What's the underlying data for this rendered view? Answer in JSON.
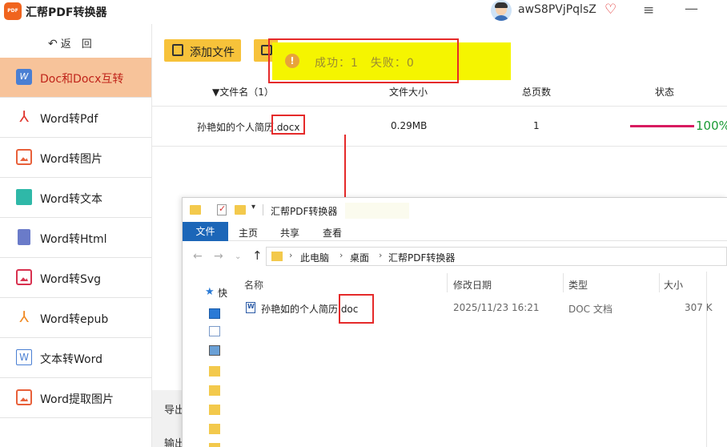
{
  "app": {
    "logo_text": "PDF",
    "title": "汇帮PDF转换器",
    "username": "awS8PVjPqlsZ",
    "icons": {
      "vip": "vip-heart-icon",
      "menu": "hamburger-menu-icon",
      "minimize": "minimize-icon"
    }
  },
  "sidebar": {
    "back_label": "返　回",
    "items": [
      {
        "label": "Doc和Docx互转",
        "icon": "word-doc-icon",
        "active": true
      },
      {
        "label": "Word转Pdf",
        "icon": "pdf-icon",
        "active": false
      },
      {
        "label": "Word转图片",
        "icon": "image-icon",
        "active": false
      },
      {
        "label": "Word转文本",
        "icon": "text-file-icon",
        "active": false
      },
      {
        "label": "Word转Html",
        "icon": "html-file-icon",
        "active": false
      },
      {
        "label": "Word转Svg",
        "icon": "svg-image-icon",
        "active": false
      },
      {
        "label": "Word转epub",
        "icon": "epub-icon",
        "active": false
      },
      {
        "label": "文本转Word",
        "icon": "word-icon",
        "active": false
      },
      {
        "label": "Word提取图片",
        "icon": "extract-image-icon",
        "active": false
      }
    ]
  },
  "toolbar": {
    "add_file_label": "添加文件"
  },
  "toast": {
    "message": "成功：1　失败：0"
  },
  "table": {
    "headers": {
      "filename": "▼文件名（1）",
      "size": "文件大小",
      "pages": "总页数",
      "status": "状态"
    },
    "rows": [
      {
        "filename": "孙艳如的个人简历.docx",
        "size": "0.29MB",
        "pages": "1",
        "progress_percent": 100,
        "progress_label": "100%"
      }
    ]
  },
  "main_bottom": {
    "label1": "导出",
    "label2": "输出"
  },
  "explorer": {
    "title": "汇帮PDF转换器",
    "ribbon": {
      "file": "文件",
      "home": "主页",
      "share": "共享",
      "view": "查看"
    },
    "breadcrumb": [
      "此电脑",
      "桌面",
      "汇帮PDF转换器"
    ],
    "nav": {
      "quick_access": "快"
    },
    "columns": {
      "name": "名称",
      "modified": "修改日期",
      "type": "类型",
      "size": "大小"
    },
    "files": [
      {
        "name": "孙艳如的个人简历.doc",
        "modified": "2025/11/23 16:21",
        "type": "DOC 文档",
        "size": "307 K"
      }
    ]
  },
  "colors": {
    "accent": "#f7c23a",
    "active_bg": "#f7c39a",
    "annotation_red": "#e52a2a",
    "toast_bg": "#f5f500",
    "progress": "#d81b60",
    "success_green": "#1a9a35"
  }
}
